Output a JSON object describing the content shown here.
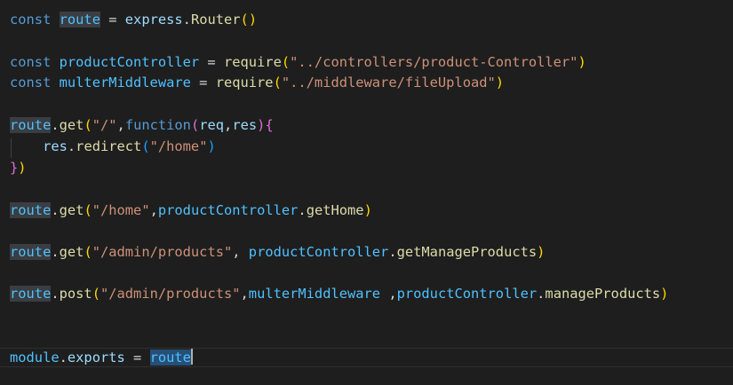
{
  "editor": {
    "lines": [
      {
        "segments": [
          [
            "const",
            "kw"
          ],
          [
            " ",
            "op"
          ],
          [
            "route",
            "var hl-soft"
          ],
          [
            " = ",
            "op"
          ],
          [
            "express",
            "id"
          ],
          [
            ".",
            "op"
          ],
          [
            "Router",
            "fn"
          ],
          [
            "()",
            "p1"
          ]
        ]
      },
      {
        "segments": []
      },
      {
        "segments": [
          [
            "const",
            "kw"
          ],
          [
            " ",
            "op"
          ],
          [
            "productController",
            "var"
          ],
          [
            " = ",
            "op"
          ],
          [
            "require",
            "fn"
          ],
          [
            "(",
            "p1"
          ],
          [
            "\"../controllers/product-Controller\"",
            "str"
          ],
          [
            ")",
            "p1"
          ]
        ]
      },
      {
        "segments": [
          [
            "const",
            "kw"
          ],
          [
            " ",
            "op"
          ],
          [
            "multerMiddleware",
            "var"
          ],
          [
            " = ",
            "op"
          ],
          [
            "require",
            "fn"
          ],
          [
            "(",
            "p1"
          ],
          [
            "\"../middleware/fileUpload\"",
            "str"
          ],
          [
            ")",
            "p1"
          ]
        ]
      },
      {
        "segments": []
      },
      {
        "segments": [
          [
            "route",
            "var hl-soft"
          ],
          [
            ".",
            "op"
          ],
          [
            "get",
            "fn"
          ],
          [
            "(",
            "p1"
          ],
          [
            "\"/\"",
            "str"
          ],
          [
            ",",
            "op"
          ],
          [
            "function",
            "kw"
          ],
          [
            "(",
            "p2"
          ],
          [
            "req",
            "id"
          ],
          [
            ",",
            "op"
          ],
          [
            "res",
            "id"
          ],
          [
            ")",
            "p2"
          ],
          [
            "{",
            "p2"
          ]
        ]
      },
      {
        "segments": [
          [
            "    ",
            "op"
          ],
          [
            "res",
            "id"
          ],
          [
            ".",
            "op"
          ],
          [
            "redirect",
            "fn"
          ],
          [
            "(",
            "p3"
          ],
          [
            "\"/home\"",
            "str"
          ],
          [
            ")",
            "p3"
          ]
        ]
      },
      {
        "segments": [
          [
            "}",
            "p2"
          ],
          [
            ")",
            "p1"
          ]
        ]
      },
      {
        "segments": []
      },
      {
        "segments": [
          [
            "route",
            "var hl-soft"
          ],
          [
            ".",
            "op"
          ],
          [
            "get",
            "fn"
          ],
          [
            "(",
            "p1"
          ],
          [
            "\"/home\"",
            "str"
          ],
          [
            ",",
            "op"
          ],
          [
            "productController",
            "var"
          ],
          [
            ".",
            "op"
          ],
          [
            "getHome",
            "fn"
          ],
          [
            ")",
            "p1"
          ]
        ]
      },
      {
        "segments": []
      },
      {
        "segments": [
          [
            "route",
            "var hl-soft"
          ],
          [
            ".",
            "op"
          ],
          [
            "get",
            "fn"
          ],
          [
            "(",
            "p1"
          ],
          [
            "\"/admin/products\"",
            "str"
          ],
          [
            ", ",
            "op"
          ],
          [
            "productController",
            "var"
          ],
          [
            ".",
            "op"
          ],
          [
            "getManageProducts",
            "fn"
          ],
          [
            ")",
            "p1"
          ]
        ]
      },
      {
        "segments": []
      },
      {
        "segments": [
          [
            "route",
            "var hl-soft"
          ],
          [
            ".",
            "op"
          ],
          [
            "post",
            "fn"
          ],
          [
            "(",
            "p1"
          ],
          [
            "\"/admin/products\"",
            "str"
          ],
          [
            ",",
            "op"
          ],
          [
            "multerMiddleware",
            "var"
          ],
          [
            " ,",
            "op"
          ],
          [
            "productController",
            "var"
          ],
          [
            ".",
            "op"
          ],
          [
            "manageProducts",
            "fn"
          ],
          [
            ")",
            "p1"
          ]
        ]
      },
      {
        "segments": []
      },
      {
        "segments": []
      },
      {
        "segments": [
          [
            "module",
            "var"
          ],
          [
            ".",
            "op"
          ],
          [
            "exports",
            "id"
          ],
          [
            " = ",
            "op"
          ],
          [
            "route",
            "var hl"
          ]
        ]
      }
    ],
    "cursor_after_last_line": true
  }
}
